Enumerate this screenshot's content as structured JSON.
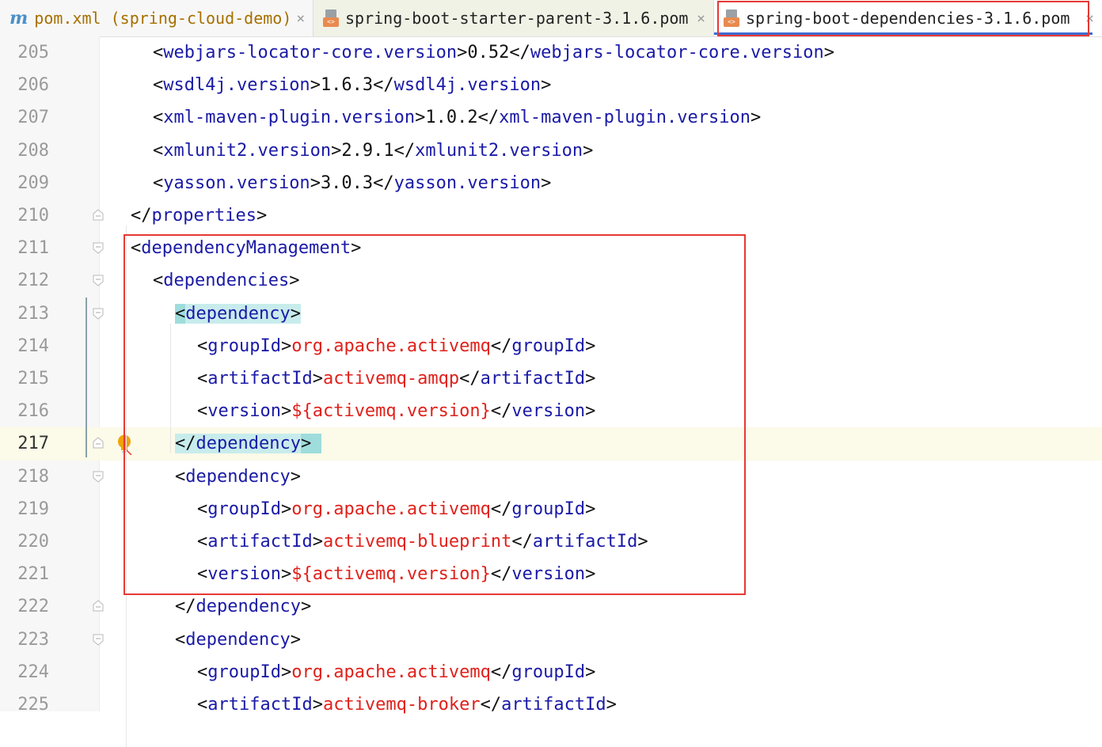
{
  "tabs": [
    {
      "label": "pom.xml (spring-cloud-demo)",
      "icon": "maven-m-icon",
      "close": "×"
    },
    {
      "label": "spring-boot-starter-parent-3.1.6.pom",
      "icon": "pom-file-icon",
      "close": "×"
    },
    {
      "label": "spring-boot-dependencies-3.1.6.pom",
      "icon": "pom-file-icon",
      "close": "×",
      "active": true
    }
  ],
  "lines": [
    {
      "n": "205",
      "indent": 2,
      "parts": [
        [
          "br",
          "<"
        ],
        [
          "tag",
          "webjars-locator-core.version"
        ],
        [
          "br",
          ">"
        ],
        [
          "val",
          "0.52"
        ],
        [
          "br",
          "</"
        ],
        [
          "tag",
          "webjars-locator-core.version"
        ],
        [
          "br",
          ">"
        ]
      ]
    },
    {
      "n": "206",
      "indent": 2,
      "parts": [
        [
          "br",
          "<"
        ],
        [
          "tag",
          "wsdl4j.version"
        ],
        [
          "br",
          ">"
        ],
        [
          "val",
          "1.6.3"
        ],
        [
          "br",
          "</"
        ],
        [
          "tag",
          "wsdl4j.version"
        ],
        [
          "br",
          ">"
        ]
      ]
    },
    {
      "n": "207",
      "indent": 2,
      "parts": [
        [
          "br",
          "<"
        ],
        [
          "tag",
          "xml-maven-plugin.version"
        ],
        [
          "br",
          ">"
        ],
        [
          "val",
          "1.0.2"
        ],
        [
          "br",
          "</"
        ],
        [
          "tag",
          "xml-maven-plugin.version"
        ],
        [
          "br",
          ">"
        ]
      ]
    },
    {
      "n": "208",
      "indent": 2,
      "parts": [
        [
          "br",
          "<"
        ],
        [
          "tag",
          "xmlunit2.version"
        ],
        [
          "br",
          ">"
        ],
        [
          "val",
          "2.9.1"
        ],
        [
          "br",
          "</"
        ],
        [
          "tag",
          "xmlunit2.version"
        ],
        [
          "br",
          ">"
        ]
      ]
    },
    {
      "n": "209",
      "indent": 2,
      "parts": [
        [
          "br",
          "<"
        ],
        [
          "tag",
          "yasson.version"
        ],
        [
          "br",
          ">"
        ],
        [
          "val",
          "3.0.3"
        ],
        [
          "br",
          "</"
        ],
        [
          "tag",
          "yasson.version"
        ],
        [
          "br",
          ">"
        ]
      ]
    },
    {
      "n": "210",
      "indent": 1,
      "fold": "end",
      "parts": [
        [
          "br",
          "</"
        ],
        [
          "tag",
          "properties"
        ],
        [
          "br",
          ">"
        ]
      ]
    },
    {
      "n": "211",
      "indent": 1,
      "fold": "start",
      "parts": [
        [
          "br",
          "<"
        ],
        [
          "tag",
          "dependencyManagement"
        ],
        [
          "br",
          ">"
        ]
      ]
    },
    {
      "n": "212",
      "indent": 2,
      "fold": "start",
      "parts": [
        [
          "br",
          "<"
        ],
        [
          "tag",
          "dependencies"
        ],
        [
          "br",
          ">"
        ]
      ]
    },
    {
      "n": "213",
      "indent": 3,
      "fold": "start",
      "parts": [
        [
          "hlbr",
          "<"
        ],
        [
          "hltag",
          "dependency"
        ],
        [
          "hlbr2",
          ">"
        ]
      ]
    },
    {
      "n": "214",
      "indent": 4,
      "parts": [
        [
          "br",
          "<"
        ],
        [
          "tag",
          "groupId"
        ],
        [
          "br",
          ">"
        ],
        [
          "str",
          "org.apache.activemq"
        ],
        [
          "br",
          "</"
        ],
        [
          "tag",
          "groupId"
        ],
        [
          "br",
          ">"
        ]
      ]
    },
    {
      "n": "215",
      "indent": 4,
      "parts": [
        [
          "br",
          "<"
        ],
        [
          "tag",
          "artifactId"
        ],
        [
          "br",
          ">"
        ],
        [
          "str",
          "activemq-amqp"
        ],
        [
          "br",
          "</"
        ],
        [
          "tag",
          "artifactId"
        ],
        [
          "br",
          ">"
        ]
      ]
    },
    {
      "n": "216",
      "indent": 4,
      "parts": [
        [
          "br",
          "<"
        ],
        [
          "tag",
          "version"
        ],
        [
          "br",
          ">"
        ],
        [
          "str",
          "${activemq.version}"
        ],
        [
          "br",
          "</"
        ],
        [
          "tag",
          "version"
        ],
        [
          "br",
          ">"
        ]
      ]
    },
    {
      "n": "217",
      "indent": 3,
      "fold": "end",
      "current": true,
      "bulb": true,
      "parts": [
        [
          "hlbr2",
          "</"
        ],
        [
          "hltag",
          "dependency"
        ],
        [
          "hlbr",
          "> "
        ]
      ]
    },
    {
      "n": "218",
      "indent": 3,
      "fold": "start",
      "parts": [
        [
          "br",
          "<"
        ],
        [
          "tag",
          "dependency"
        ],
        [
          "br",
          ">"
        ]
      ]
    },
    {
      "n": "219",
      "indent": 4,
      "parts": [
        [
          "br",
          "<"
        ],
        [
          "tag",
          "groupId"
        ],
        [
          "br",
          ">"
        ],
        [
          "str",
          "org.apache.activemq"
        ],
        [
          "br",
          "</"
        ],
        [
          "tag",
          "groupId"
        ],
        [
          "br",
          ">"
        ]
      ]
    },
    {
      "n": "220",
      "indent": 4,
      "parts": [
        [
          "br",
          "<"
        ],
        [
          "tag",
          "artifactId"
        ],
        [
          "br",
          ">"
        ],
        [
          "str",
          "activemq-blueprint"
        ],
        [
          "br",
          "</"
        ],
        [
          "tag",
          "artifactId"
        ],
        [
          "br",
          ">"
        ]
      ]
    },
    {
      "n": "221",
      "indent": 4,
      "parts": [
        [
          "br",
          "<"
        ],
        [
          "tag",
          "version"
        ],
        [
          "br",
          ">"
        ],
        [
          "str",
          "${activemq.version}"
        ],
        [
          "br",
          "</"
        ],
        [
          "tag",
          "version"
        ],
        [
          "br",
          ">"
        ]
      ]
    },
    {
      "n": "222",
      "indent": 3,
      "fold": "end",
      "parts": [
        [
          "br",
          "</"
        ],
        [
          "tag",
          "dependency"
        ],
        [
          "br",
          ">"
        ]
      ]
    },
    {
      "n": "223",
      "indent": 3,
      "fold": "start",
      "parts": [
        [
          "br",
          "<"
        ],
        [
          "tag",
          "dependency"
        ],
        [
          "br",
          ">"
        ]
      ]
    },
    {
      "n": "224",
      "indent": 4,
      "parts": [
        [
          "br",
          "<"
        ],
        [
          "tag",
          "groupId"
        ],
        [
          "br",
          ">"
        ],
        [
          "str",
          "org.apache.activemq"
        ],
        [
          "br",
          "</"
        ],
        [
          "tag",
          "groupId"
        ],
        [
          "br",
          ">"
        ]
      ]
    },
    {
      "n": "225",
      "indent": 4,
      "parts": [
        [
          "br",
          "<"
        ],
        [
          "tag",
          "artifactId"
        ],
        [
          "br",
          ">"
        ],
        [
          "str",
          "activemq-broker"
        ],
        [
          "br",
          "</"
        ],
        [
          "tag",
          "artifactId"
        ],
        [
          "br",
          ">"
        ]
      ]
    }
  ],
  "colors": {
    "tag": "#1a1aa6",
    "string": "#e0211b",
    "highlight": "#c8ecec",
    "annotation": "#e53935",
    "active_tab_underline": "#3f6bd1"
  }
}
